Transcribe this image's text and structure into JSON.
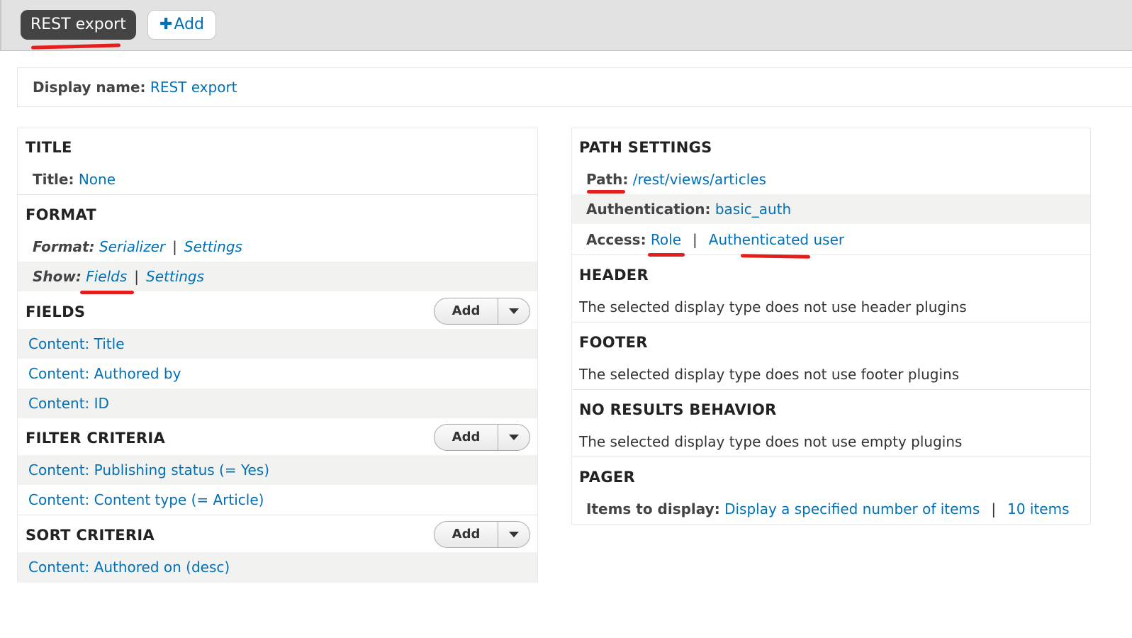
{
  "tabs": {
    "active_label": "REST export",
    "add_label": "Add",
    "add_icon": "plus-icon"
  },
  "display_name": {
    "label": "Display name:",
    "value": "REST export"
  },
  "left": {
    "title": {
      "heading": "TITLE",
      "label": "Title:",
      "value": "None"
    },
    "format": {
      "heading": "FORMAT",
      "format_label": "Format:",
      "format_value": "Serializer",
      "format_settings": "Settings",
      "show_label": "Show:",
      "show_value": "Fields",
      "show_settings": "Settings",
      "separator": "|"
    },
    "fields": {
      "heading": "FIELDS",
      "add_label": "Add",
      "items": [
        "Content: Title",
        "Content: Authored by",
        "Content: ID"
      ]
    },
    "filter": {
      "heading": "FILTER CRITERIA",
      "add_label": "Add",
      "items": [
        "Content: Publishing status (= Yes)",
        "Content: Content type (= Article)"
      ]
    },
    "sort": {
      "heading": "SORT CRITERIA",
      "add_label": "Add",
      "items": [
        "Content: Authored on (desc)"
      ]
    }
  },
  "right": {
    "path": {
      "heading": "PATH SETTINGS",
      "path_label": "Path:",
      "path_value": "/rest/views/articles",
      "auth_label": "Authentication:",
      "auth_value": "basic_auth",
      "access_label": "Access:",
      "access_value": "Role",
      "access_role": "Authenticated user",
      "separator": "|"
    },
    "header": {
      "heading": "HEADER",
      "text": "The selected display type does not use header plugins"
    },
    "footer": {
      "heading": "FOOTER",
      "text": "The selected display type does not use footer plugins"
    },
    "no_results": {
      "heading": "NO RESULTS BEHAVIOR",
      "text": "The selected display type does not use empty plugins"
    },
    "pager": {
      "heading": "PAGER",
      "label": "Items to display:",
      "value": "Display a specified number of items",
      "count": "10 items",
      "separator": "|"
    }
  },
  "colors": {
    "link": "#0071b8",
    "annotation": "#e41d1d",
    "active_tab": "#444444"
  }
}
